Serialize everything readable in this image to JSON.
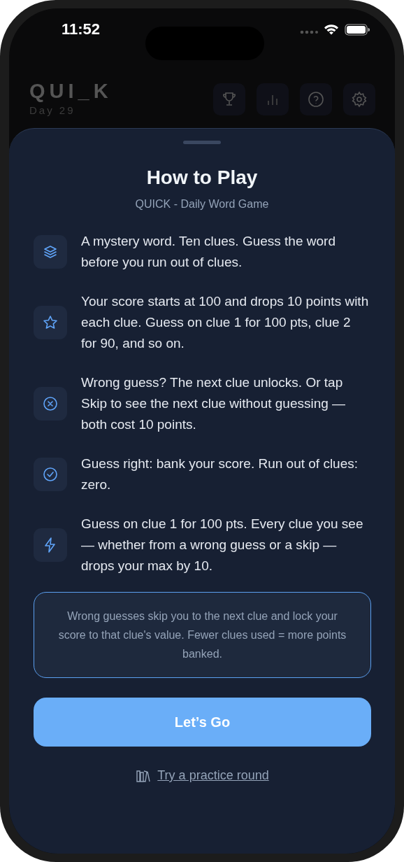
{
  "status_bar": {
    "time": "11:52"
  },
  "header": {
    "title": "QUI_K",
    "subtitle": "Day 29"
  },
  "sheet": {
    "title": "How to Play",
    "subtitle": "QUICK - Daily Word Game",
    "rules": [
      {
        "kind": "layers",
        "text": "A mystery word. Ten clues. Guess the word before you run out of clues."
      },
      {
        "kind": "star",
        "text": "Your score starts at 100 and drops 10 points with each clue. Guess on clue 1 for 100 pts, clue 2 for 90, and so on."
      },
      {
        "kind": "cross",
        "text": "Wrong guess? The next clue unlocks. Or tap Skip to see the next clue without guessing — both cost 10 points."
      },
      {
        "kind": "check",
        "text": "Guess right: bank your score. Run out of clues: zero."
      },
      {
        "kind": "bolt",
        "text": "Guess on clue 1 for 100 pts. Every clue you see — whether from a wrong guess or a skip — drops your max by 10."
      }
    ],
    "note": "Wrong guesses skip you to the next clue and lock your score to that clue's value. Fewer clues used = more points banked.",
    "primary_button": "Let’s Go",
    "link": "Try a practice round"
  }
}
